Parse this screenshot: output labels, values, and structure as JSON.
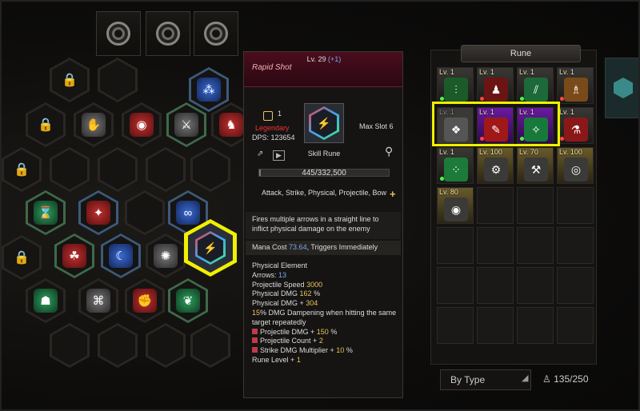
{
  "tooltip": {
    "title": "Rapid Shot",
    "level_label": "Lv. 29",
    "level_bonus": "(+1)",
    "grade_number": "1",
    "rarity": "Legendary",
    "dps": "DPS: 123654",
    "max_slot": "Max Slot 6",
    "rune_type": "Skill Rune",
    "xp_text": "445/332,500",
    "xp_fraction": 0.0013,
    "tags": "Attack, Strike, Physical, Projectile, Bow",
    "description": "Fires multiple arrows in a straight line to inflict physical damage on the enemy",
    "mana_label": "Mana Cost",
    "mana_value": "73.64",
    "mana_suffix": ", Triggers Immediately",
    "stats": {
      "element": "Physical Element",
      "arrows_label": "Arrows:",
      "arrows_value": "13",
      "proj_speed_label": "Projectile Speed",
      "proj_speed_value": "3000",
      "phys_dmg_label": "Physical DMG",
      "phys_dmg_value": "162",
      "phys_dmg_unit": "%",
      "phys_flat_label": "Physical DMG +",
      "phys_flat_value": "304",
      "dampen_value": "15",
      "dampen_text": "% DMG Dampening when hitting the same target repeatedly",
      "bonus1_label": "Projectile DMG +",
      "bonus1_value": "150",
      "bonus1_unit": "%",
      "bonus2_label": "Projectile Count +",
      "bonus2_value": "2",
      "bonus3_label": "Strike DMG Multiplier +",
      "bonus3_value": "10",
      "bonus3_unit": "%",
      "rune_level_label": "Rune Level +",
      "rune_level_value": "1"
    }
  },
  "rune_panel": {
    "title": "Rune",
    "items": [
      {
        "lv": "Lv. 1"
      },
      {
        "lv": "Lv. 1"
      },
      {
        "lv": "Lv. 1"
      },
      {
        "lv": "Lv. 1"
      },
      {
        "lv": "Lv. 1"
      },
      {
        "lv": "Lv. 1"
      },
      {
        "lv": "Lv. 1"
      },
      {
        "lv": "Lv. 1"
      },
      {
        "lv": "Lv. 1"
      },
      {
        "lv": "Lv. 100"
      },
      {
        "lv": "Lv. 70"
      },
      {
        "lv": "Lv. 100"
      },
      {
        "lv": "Lv. 80"
      }
    ],
    "sort_label": "By Type",
    "capacity": "135/250"
  }
}
